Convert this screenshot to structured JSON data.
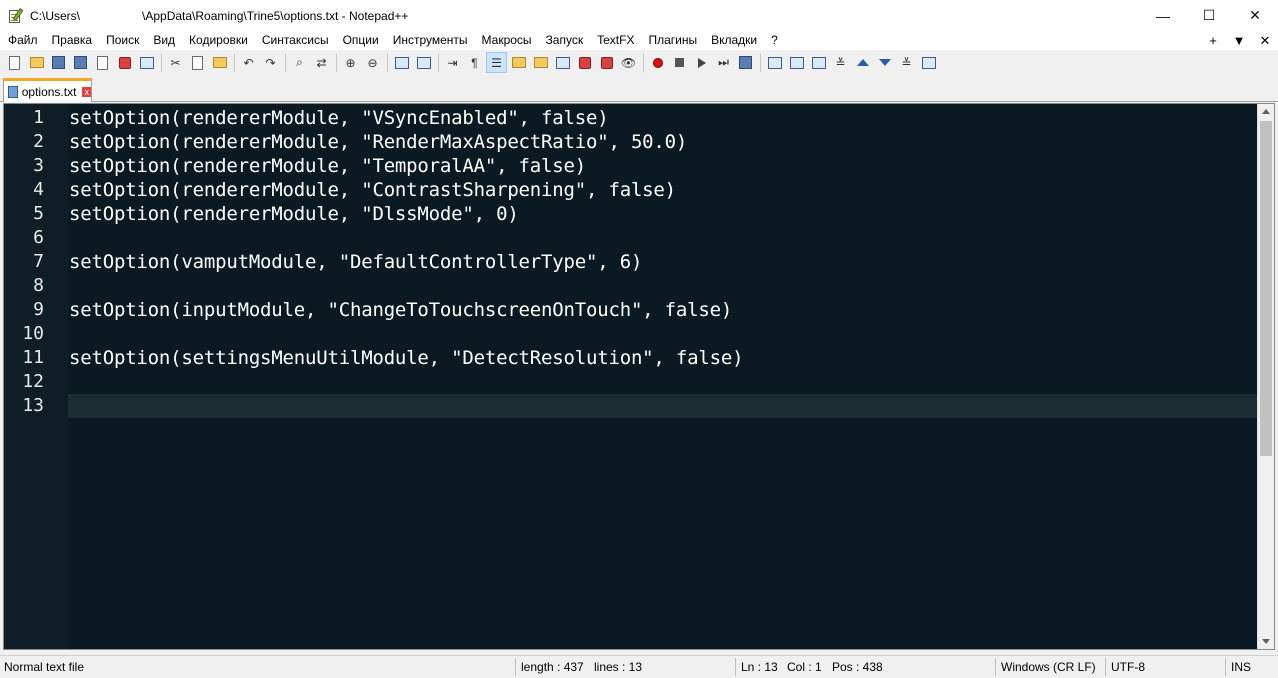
{
  "title": "C:\\Users\\",
  "title_rest": "\\AppData\\Roaming\\Trine5\\options.txt - Notepad++",
  "window_controls": {
    "minimize": "—",
    "maximize": "☐",
    "close": "✕"
  },
  "menu": [
    "Файл",
    "Правка",
    "Поиск",
    "Вид",
    "Кодировки",
    "Синтаксисы",
    "Опции",
    "Инструменты",
    "Макросы",
    "Запуск",
    "TextFX",
    "Плагины",
    "Вкладки",
    "?"
  ],
  "menu_right": [
    "+",
    "▼",
    "✕"
  ],
  "tab": {
    "label": "options.txt",
    "close": "x"
  },
  "editor": {
    "lines": [
      {
        "n": "1",
        "text": "setOption(rendererModule, \"VSyncEnabled\", false)"
      },
      {
        "n": "2",
        "text": "setOption(rendererModule, \"RenderMaxAspectRatio\", 50.0)"
      },
      {
        "n": "3",
        "text": "setOption(rendererModule, \"TemporalAA\", false)"
      },
      {
        "n": "4",
        "text": "setOption(rendererModule, \"ContrastSharpening\", false)"
      },
      {
        "n": "5",
        "text": "setOption(rendererModule, \"DlssMode\", 0)"
      },
      {
        "n": "6",
        "text": ""
      },
      {
        "n": "7",
        "text": "setOption(vamputModule, \"DefaultControllerType\", 6)"
      },
      {
        "n": "8",
        "text": ""
      },
      {
        "n": "9",
        "text": "setOption(inputModule, \"ChangeToTouchscreenOnTouch\", false)"
      },
      {
        "n": "10",
        "text": ""
      },
      {
        "n": "11",
        "text": "setOption(settingsMenuUtilModule, \"DetectResolution\", false)"
      },
      {
        "n": "12",
        "text": ""
      },
      {
        "n": "13",
        "text": ""
      }
    ],
    "background": "#0b1a22",
    "current_line": "13"
  },
  "status": {
    "file_type": "Normal text file",
    "length": "length : 437",
    "lines": "lines : 13",
    "ln": "Ln : 13",
    "col": "Col : 1",
    "pos": "Pos : 438",
    "eol": "Windows (CR LF)",
    "encoding": "UTF-8",
    "mode": "INS"
  }
}
